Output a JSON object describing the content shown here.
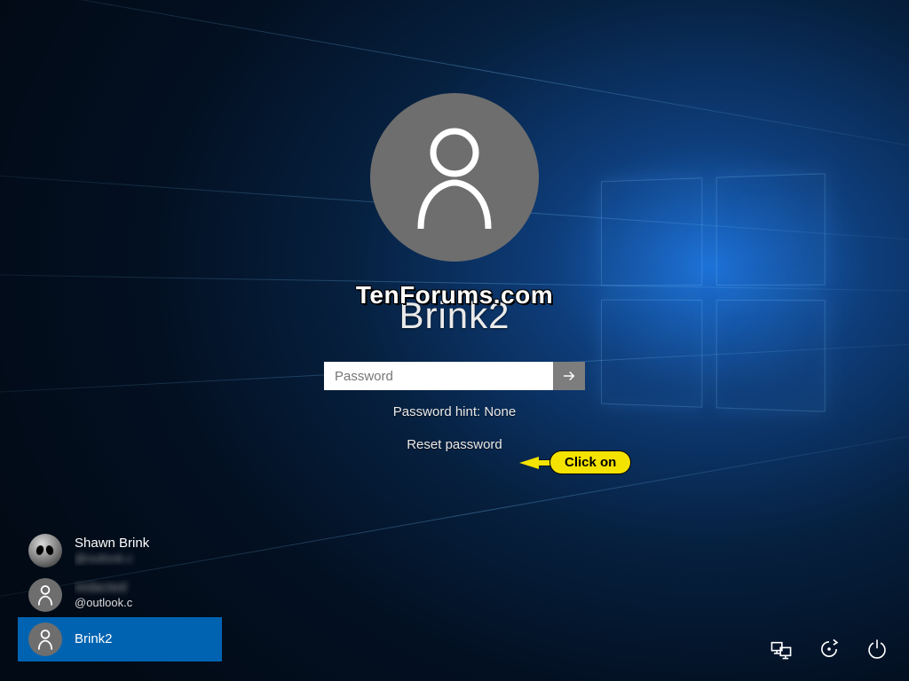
{
  "watermark": "TenForums.com",
  "current_user": "Brink2",
  "password": {
    "placeholder": "Password",
    "value": ""
  },
  "hint_label": "Password hint: None",
  "reset_label": "Reset password",
  "callout_text": "Click on",
  "users": [
    {
      "name": "Shawn Brink",
      "email": "@outlook.c",
      "avatar": "alien",
      "name_blur": false,
      "email_blur": true
    },
    {
      "name": "redacted",
      "email": "@outlook.c",
      "avatar": "generic",
      "name_blur": true,
      "email_blur": false
    },
    {
      "name": "Brink2",
      "email": "",
      "avatar": "generic",
      "name_blur": false,
      "email_blur": false,
      "selected": true
    }
  ],
  "icons": {
    "network": "network-icon",
    "ease": "ease-of-access-icon",
    "power": "power-icon"
  }
}
